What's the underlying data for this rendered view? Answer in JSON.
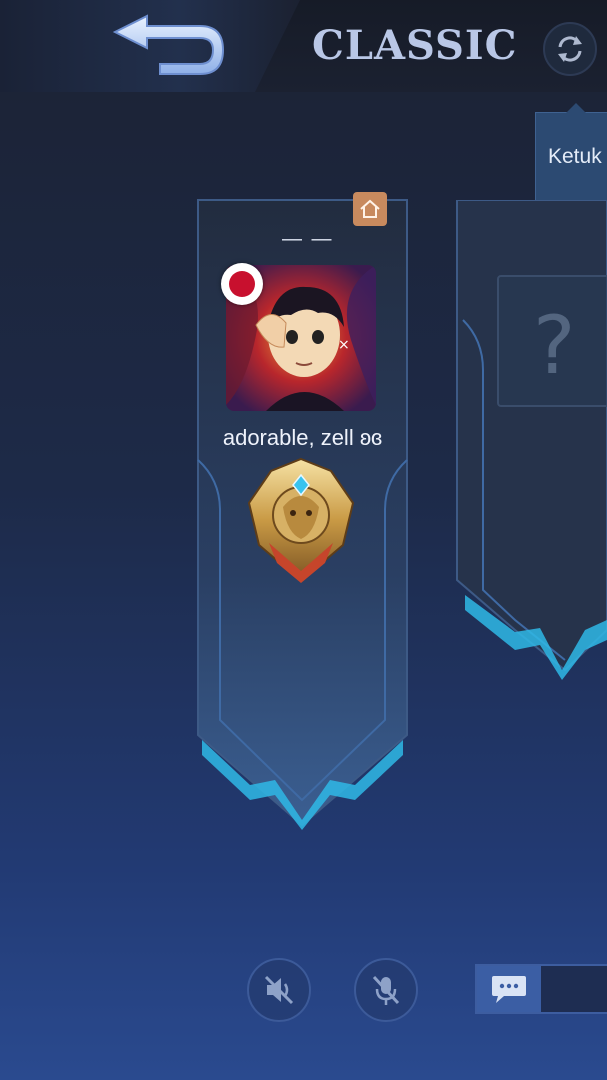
{
  "header": {
    "mode_title": "CLASSIC",
    "back_icon": "back-arrow-icon",
    "refresh_icon": "refresh-icon"
  },
  "tooltip": {
    "text": "Ketuk"
  },
  "player_slot": {
    "home_icon": "home-icon",
    "dash_text": "— —",
    "name": "adorable, zell ʚɞ",
    "flag_icon": "japan-flag-icon",
    "rank_icon": "mythic-lion-rank-icon"
  },
  "empty_slot": {
    "placeholder": "?"
  },
  "bottom_bar": {
    "speaker_icon": "speaker-muted-icon",
    "mic_icon": "mic-muted-icon",
    "chat_icon": "chat-bubble-icon"
  },
  "colors": {
    "accent_cyan": "#2fb8e6",
    "title": "#b9c7e6",
    "flag_red": "#c8102e",
    "home_badge": "#c88a5e"
  }
}
